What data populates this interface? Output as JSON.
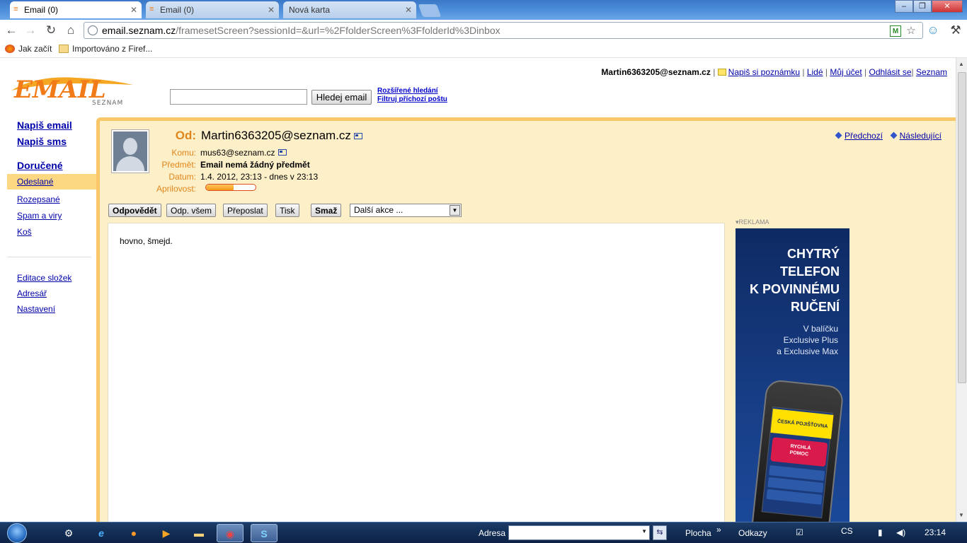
{
  "browser": {
    "tabs": [
      {
        "label": "Email (0)",
        "active": true
      },
      {
        "label": "Email (0)",
        "active": false
      },
      {
        "label": "Nová karta",
        "active": false
      }
    ],
    "url_host": "email.seznam.cz",
    "url_path": "/framesetScreen?sessionId=&url=%2FfolderScreen%3FfolderId%3Dinbox",
    "bookmarks": [
      {
        "label": "Jak začít"
      },
      {
        "label": "Importováno z Firef..."
      }
    ]
  },
  "header": {
    "logo_text": "EMAIL",
    "logo_sub": "SEZNAM",
    "search_button": "Hledej email",
    "advanced_search": "Rozšířené hledání",
    "filter_link": "Filtruj příchozí poštu",
    "user": "Martin6363205@seznam.cz",
    "links": [
      "Napiš si poznámku",
      "Lidé",
      "Můj účet",
      "Odhlásit se",
      "Seznam"
    ]
  },
  "sidebar": {
    "compose_email": "Napiš email",
    "compose_sms": "Napiš sms",
    "folders": [
      "Doručené",
      "Odeslané",
      "Rozepsané",
      "Spam a viry",
      "Koš"
    ],
    "tools": [
      "Editace složek",
      "Adresář",
      "Nastavení"
    ]
  },
  "message": {
    "from_label": "Od:",
    "from": "Martin6363205@seznam.cz",
    "to_label": "Komu:",
    "to": "mus63@seznam.cz",
    "subject_label": "Předmět:",
    "subject": "Email nemá žádný předmět",
    "date_label": "Datum:",
    "date": "1.4. 2012, 23:13 - dnes v 23:13",
    "priority_label": "Aprilovost:",
    "priority_level": 0.55,
    "prev": "Předchozí",
    "next": "Následující",
    "body": "hovno, šmejd."
  },
  "actions": {
    "reply": "Odpovědět",
    "reply_all": "Odp. všem",
    "forward": "Přeposlat",
    "print": "Tisk",
    "delete": "Smaž",
    "more": "Další akce ..."
  },
  "ad": {
    "label": "REKLAMA",
    "lines": [
      "CHYTRÝ",
      "TELEFON",
      "K POVINNÉMU",
      "RUČENÍ"
    ],
    "sub": [
      "V balíčku",
      "Exclusive Plus",
      "a Exclusive Max"
    ],
    "phone_brand": "ČESKÁ POJIŠŤOVNA",
    "phone_button": "RYCHLÁ POMOC"
  },
  "taskbar": {
    "address_label": "Adresa",
    "desktop_label": "Plocha",
    "links_label": "Odkazy",
    "lang": "CS",
    "time": "23:14"
  },
  "colors": {
    "accent_orange": "#e0851b",
    "frame_yellow": "#fdf0c8",
    "link_blue": "#0000aa"
  }
}
